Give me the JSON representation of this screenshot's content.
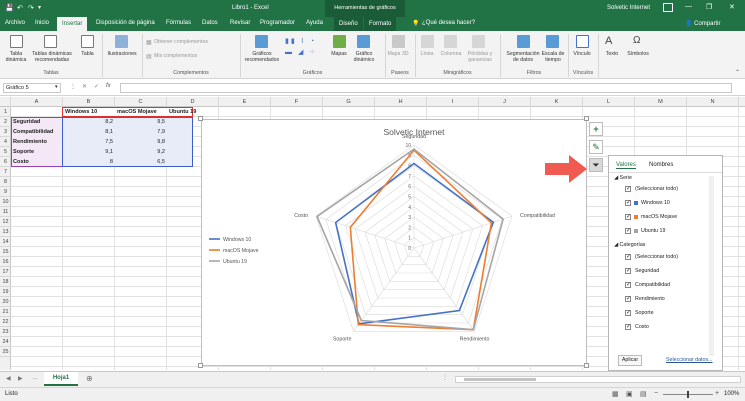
{
  "window": {
    "title": "Libro1 - Excel",
    "tools_label": "Herramientas de gráficos",
    "user": "Solvetic Internet",
    "controls": [
      "—",
      "❐",
      "✕"
    ]
  },
  "tabs": [
    "Archivo",
    "Inicio",
    "Insertar",
    "Disposición de página",
    "Fórmulas",
    "Datos",
    "Revisar",
    "Programador",
    "Ayuda",
    "Diseño",
    "Formato"
  ],
  "tell_me": "¿Qué desea hacer?",
  "share": "Compartir",
  "ribbon": {
    "buttons": [
      {
        "label": "Tabla dinámica"
      },
      {
        "label": "Tablas dinámicas recomendadas"
      },
      {
        "label": "Tabla"
      },
      {
        "label": "Ilustraciones"
      },
      {
        "label": "Obtener complementos"
      },
      {
        "label": "Mis complementos"
      },
      {
        "label": "Gráficos recomendados"
      },
      {
        "label": "Mapas"
      },
      {
        "label": "Gráfico dinámico"
      },
      {
        "label": "Mapa 3D"
      },
      {
        "label": "Línea"
      },
      {
        "label": "Columna"
      },
      {
        "label": "Pérdidas y ganancias"
      },
      {
        "label": "Segmentación de datos"
      },
      {
        "label": "Escala de tiempo"
      },
      {
        "label": "Vínculo"
      },
      {
        "label": "Texto"
      },
      {
        "label": "Símbolos"
      }
    ],
    "groups": [
      "Tablas",
      "Complementos",
      "Gráficos",
      "Paseos",
      "Minigráficos",
      "Filtros",
      "Vínculos"
    ]
  },
  "namebox": "Gráfico 5",
  "fx": "fx",
  "columns": [
    "A",
    "B",
    "C",
    "D",
    "E",
    "F",
    "G",
    "H",
    "I",
    "J",
    "K",
    "L",
    "M",
    "N",
    "O",
    "P"
  ],
  "rows": [
    "1",
    "2",
    "3",
    "4",
    "5",
    "6",
    "7",
    "8",
    "9",
    "10",
    "11",
    "12",
    "13",
    "14",
    "15",
    "16",
    "17",
    "18",
    "19",
    "20",
    "21",
    "22",
    "23",
    "24",
    "25"
  ],
  "table": {
    "headers": [
      "",
      "Windows 10",
      "macOS Mojave",
      "Ubuntu 19"
    ],
    "rows": [
      {
        "label": "Seguridad",
        "values": [
          "8,2",
          "9,5",
          "9,6"
        ]
      },
      {
        "label": "Compatibilidad",
        "values": [
          "8,1",
          "7,9",
          "9,1"
        ]
      },
      {
        "label": "Rendimiento",
        "values": [
          "7,5",
          "9,8",
          "9,8"
        ]
      },
      {
        "label": "Soporte",
        "values": [
          "9,1",
          "9,2",
          "8,7"
        ]
      },
      {
        "label": "Costo",
        "values": [
          "8",
          "6,5",
          "9,9"
        ]
      }
    ]
  },
  "chart_data": {
    "type": "radar",
    "title": "Solvetic Internet",
    "categories": [
      "Seguridad",
      "Compatibilidad",
      "Rendimiento",
      "Soporte",
      "Costo"
    ],
    "rlim": [
      0,
      10
    ],
    "ticks": [
      "0",
      "1",
      "2",
      "3",
      "4",
      "5",
      "6",
      "7",
      "8",
      "9",
      "10"
    ],
    "series": [
      {
        "name": "Windows 10",
        "values": [
          8.2,
          8.1,
          7.5,
          9.1,
          8
        ],
        "color": "#4472c4"
      },
      {
        "name": "macOS Mojave",
        "values": [
          9.5,
          7.9,
          9.8,
          9.2,
          6.5
        ],
        "color": "#ed7d31"
      },
      {
        "name": "Ubuntu 19",
        "values": [
          9.6,
          9.1,
          9.8,
          8.7,
          9.9
        ],
        "color": "#a5a5a5"
      }
    ],
    "legend": "left",
    "grid": true
  },
  "filter_panel": {
    "tabs": [
      "Valores",
      "Nombres"
    ],
    "serie_header": "Serie",
    "serie_items": [
      "(Seleccionar todo)",
      "Windows 10",
      "macOS Mojave",
      "Ubuntu 19"
    ],
    "cat_header": "Categorías",
    "cat_items": [
      "(Seleccionar todo)",
      "Seguridad",
      "Compatibilidad",
      "Rendimiento",
      "Soporte",
      "Costo"
    ],
    "apply": "Aplicar",
    "select_data": "Seleccionar datos..."
  },
  "sheet_tab": "Hoja1",
  "status": {
    "ready": "Listo",
    "zoom": "100%"
  },
  "colors": {
    "brand": "#217346",
    "arrow": "#f05a50"
  }
}
